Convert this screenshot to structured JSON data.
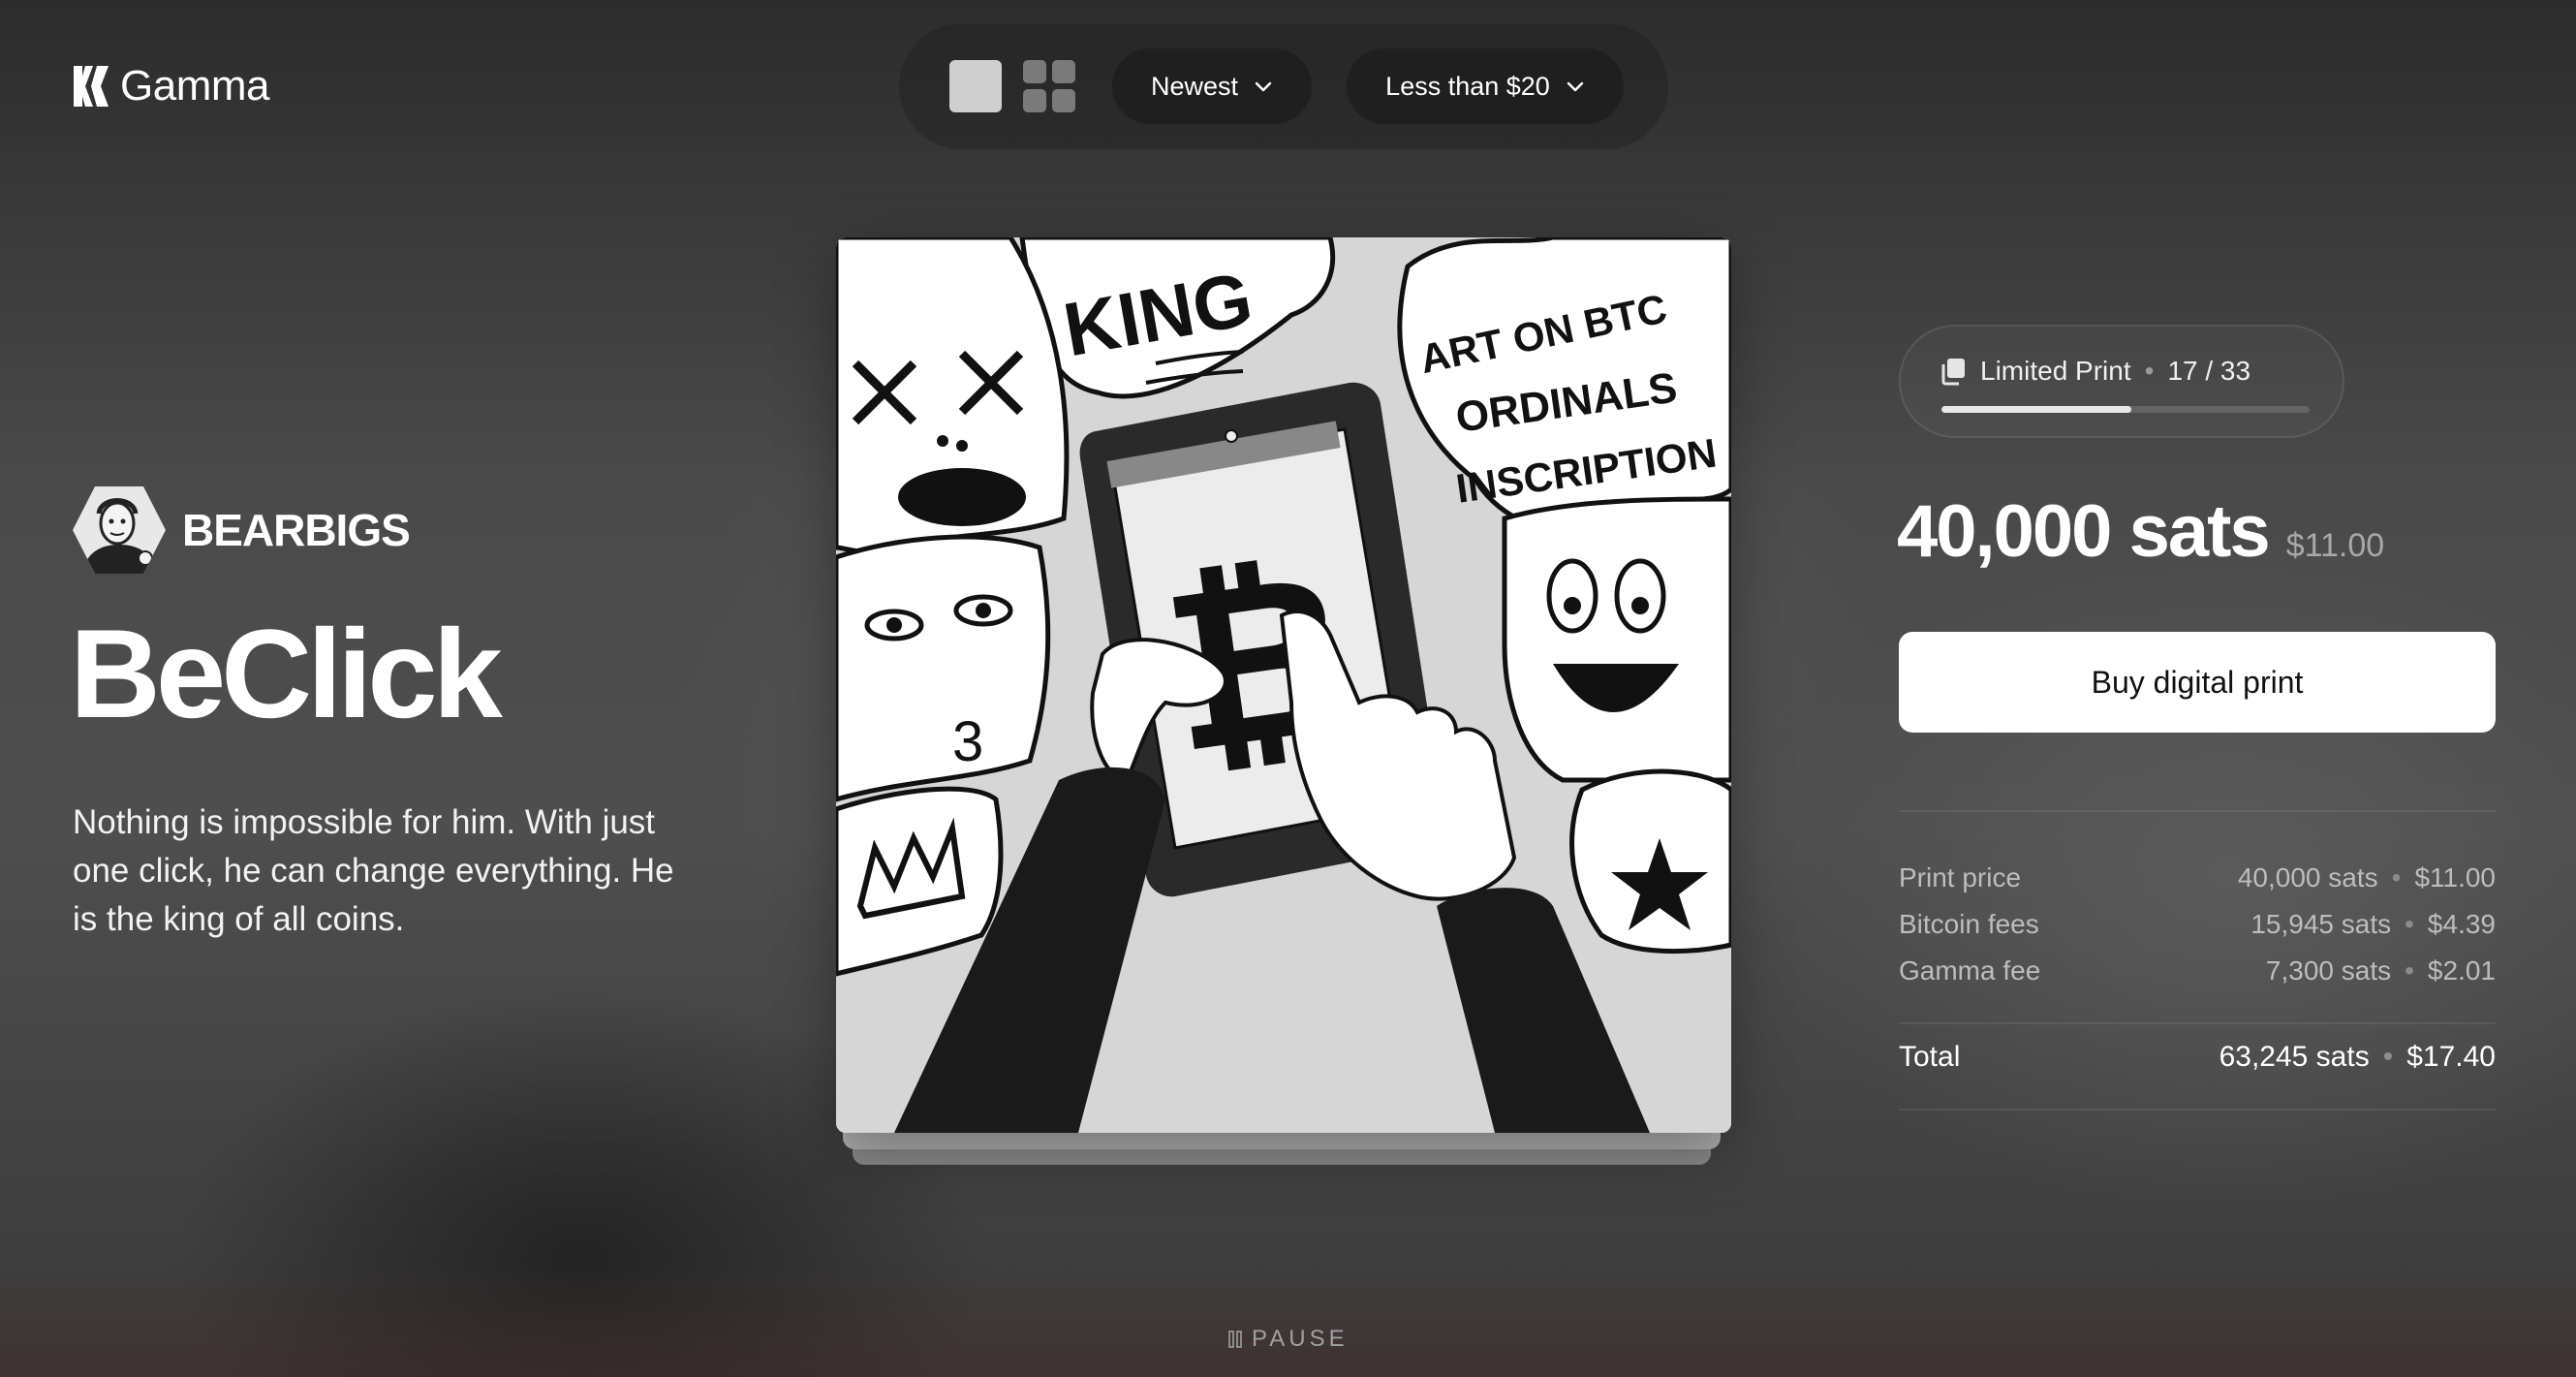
{
  "brand": {
    "name": "Gamma"
  },
  "toolbar": {
    "view_modes": [
      "single",
      "grid"
    ],
    "sort_label": "Newest",
    "price_filter_label": "Less than $20"
  },
  "artwork": {
    "artist": "BEARBIGS",
    "title": "BeClick",
    "description": "Nothing is impossible for him. With just one click, he can change everything. He is the king of all coins.",
    "image_text": [
      "KING",
      "ART ON BTC",
      "ORDINALS",
      "INSCRIPTION",
      "3"
    ]
  },
  "edition": {
    "label": "Limited Print",
    "count": "17 / 33",
    "progress_fraction": 0.515
  },
  "price": {
    "sats": "40,000 sats",
    "usd": "$11.00"
  },
  "buy_button_label": "Buy digital print",
  "fees": [
    {
      "label": "Print price",
      "sats": "40,000 sats",
      "usd": "$11.00"
    },
    {
      "label": "Bitcoin fees",
      "sats": "15,945 sats",
      "usd": "$4.39"
    },
    {
      "label": "Gamma fee",
      "sats": "7,300 sats",
      "usd": "$2.01"
    }
  ],
  "total": {
    "label": "Total",
    "sats": "63,245 sats",
    "usd": "$17.40"
  },
  "playback": {
    "pause_label": "PAUSE"
  },
  "colors": {
    "accent": "#ffffff",
    "background": "#4a4a4a",
    "pill": "#1f1f1f"
  }
}
